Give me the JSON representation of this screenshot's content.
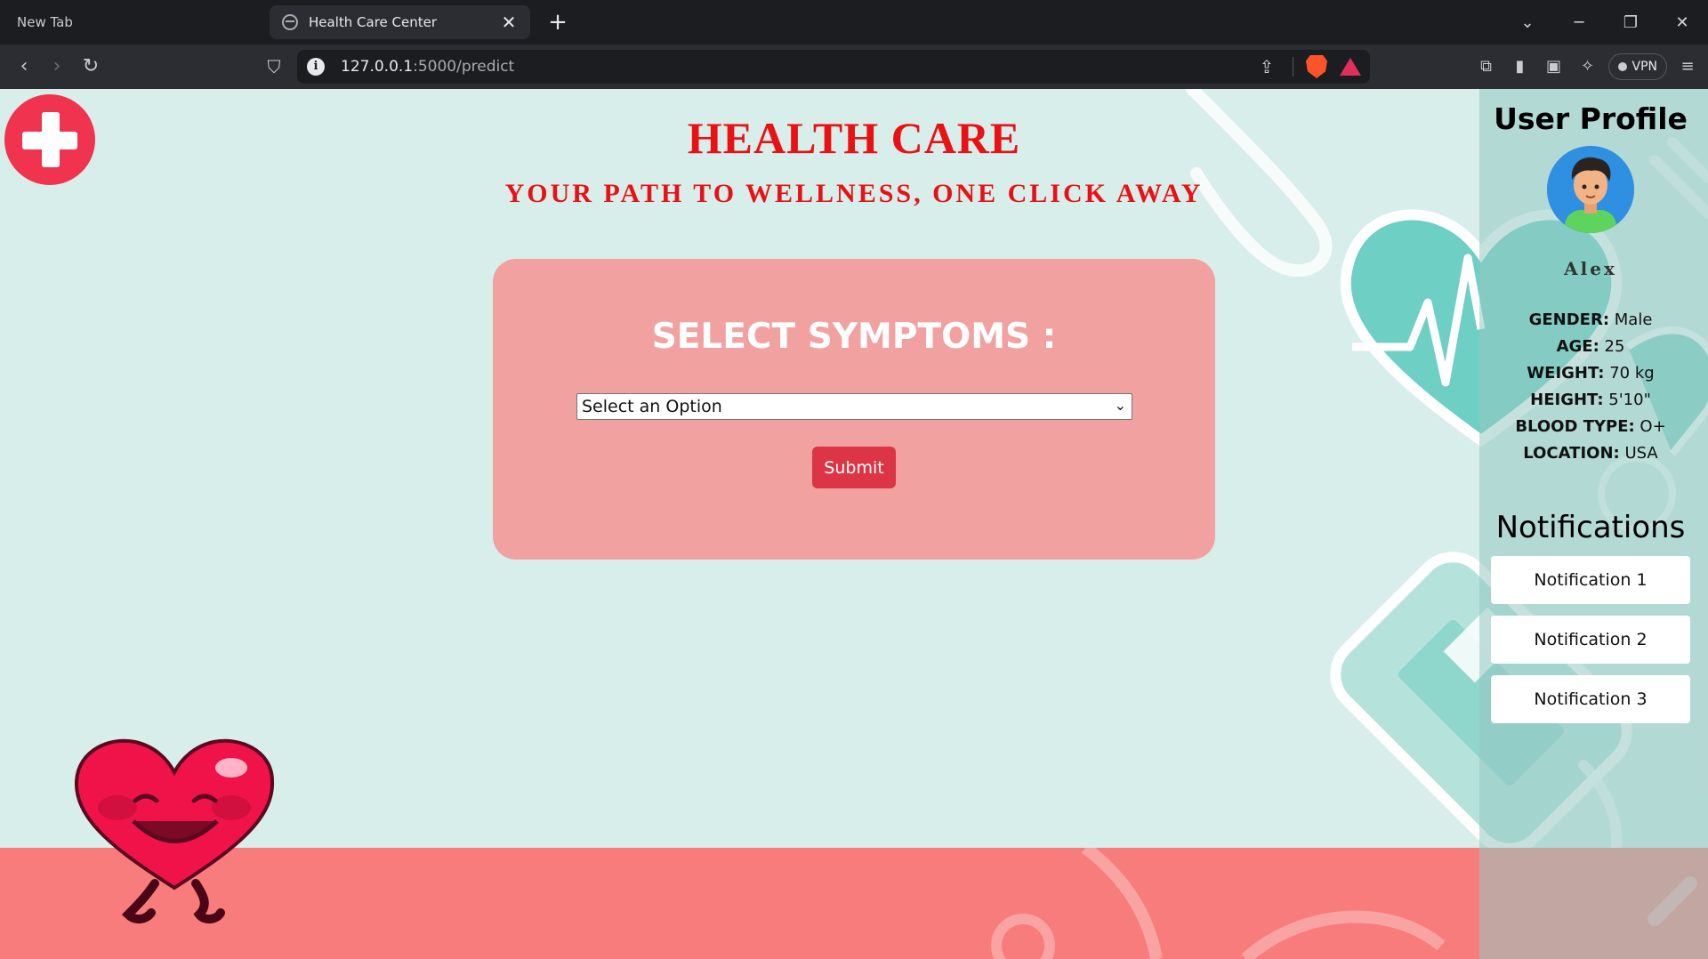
{
  "browser": {
    "inactive_tab_title": "New Tab",
    "active_tab_title": "Health Care Center",
    "url_host": "127.0.0.1",
    "url_path": ":5000/predict",
    "vpn_label": "VPN"
  },
  "header": {
    "title": "HEALTH CARE",
    "subtitle": "YOUR PATH TO WELLNESS, ONE CLICK AWAY"
  },
  "symptom_form": {
    "heading": "SELECT SYMPTOMS :",
    "select_value": "Select an Option",
    "submit_label": "Submit"
  },
  "profile": {
    "heading": "User Profile",
    "name": "Alex",
    "details": [
      {
        "label": "GENDER:",
        "value": "Male"
      },
      {
        "label": "AGE:",
        "value": "25"
      },
      {
        "label": "WEIGHT:",
        "value": "70 kg"
      },
      {
        "label": "HEIGHT:",
        "value": "5'10\""
      },
      {
        "label": "BLOOD TYPE:",
        "value": "O+"
      },
      {
        "label": "LOCATION:",
        "value": "USA"
      }
    ]
  },
  "notifications": {
    "heading": "Notifications",
    "items": [
      "Notification 1",
      "Notification 2",
      "Notification 3"
    ]
  },
  "icons": {
    "logo": "medical-cross-icon",
    "mascot": "smiling-heart-mascot",
    "tab_favicon": "globe-icon",
    "site_info": "info-icon",
    "brave": "brave-lion-icon",
    "rewards": "bat-triangle-icon"
  },
  "colors": {
    "title_red": "#ea1115",
    "card_pink": "#f0a1a0",
    "submit_red": "#dc3545",
    "footer_coral": "#f77c7b",
    "page_mint": "#d8eeea"
  }
}
